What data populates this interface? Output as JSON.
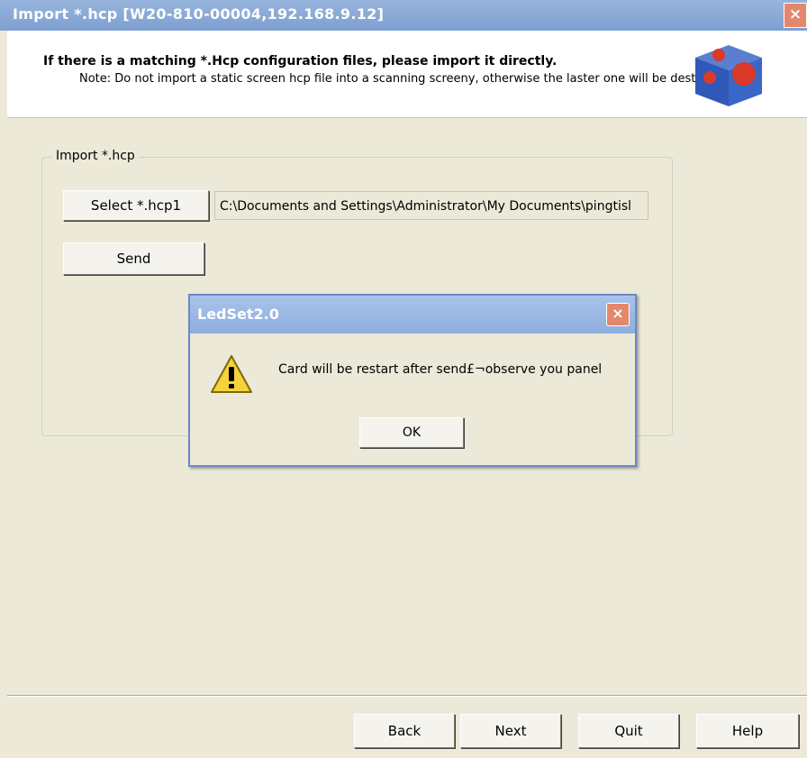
{
  "window": {
    "title": "Import *.hcp [W20-810-00004,192.168.9.12]",
    "close_glyph": "×"
  },
  "banner": {
    "heading": "If there is a matching *.Hcp configuration files, please import it directly.",
    "note": "Note: Do not import a static screen hcp file into a scanning screeny, otherwise the laster one will be destroyed."
  },
  "import_group": {
    "label": "Import *.hcp",
    "select_label": "Select *.hcp1",
    "path_value": "C:\\Documents and Settings\\Administrator\\My Documents\\pingtisl",
    "send_label": "Send"
  },
  "dialog": {
    "title": "LedSet2.0",
    "close_glyph": "×",
    "message": "Card will be restart after send£¬observe you panel",
    "ok_label": "OK"
  },
  "footer": {
    "back": "Back",
    "next": "Next",
    "quit": "Quit",
    "help": "Help"
  }
}
